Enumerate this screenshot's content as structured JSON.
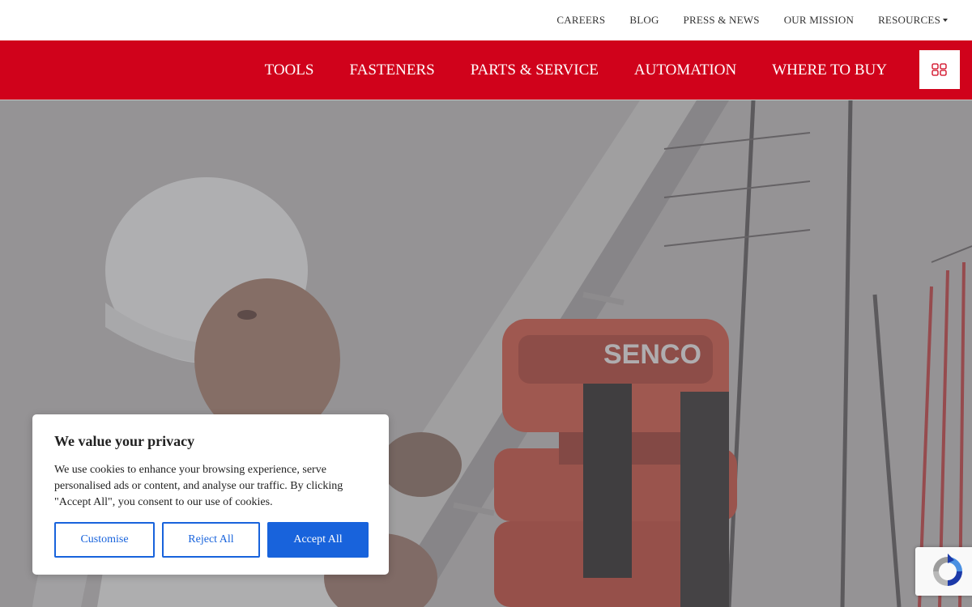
{
  "top_bar": {
    "links": [
      {
        "label": "CAREERS"
      },
      {
        "label": "BLOG"
      },
      {
        "label": "PRESS & NEWS"
      },
      {
        "label": "OUR MISSION"
      },
      {
        "label": "RESOURCES"
      }
    ]
  },
  "main_nav": {
    "items": [
      {
        "label": "TOOLS"
      },
      {
        "label": "FASTENERS"
      },
      {
        "label": "PARTS & SERVICE"
      },
      {
        "label": "AUTOMATION"
      },
      {
        "label": "WHERE TO BUY"
      }
    ],
    "menu_icon": "grid-icon",
    "brand_color": "#d0021b"
  },
  "hero": {
    "tool_brand": "SENCO"
  },
  "cookie_banner": {
    "title": "We value your privacy",
    "text": "We use cookies to enhance your browsing experience, serve personalised ads or content, and analyse our traffic. By clicking \"Accept All\", you consent to our use of cookies.",
    "customise_label": "Customise",
    "reject_label": "Reject All",
    "accept_label": "Accept All",
    "accent_color": "#1863dc"
  },
  "recaptcha": {
    "icon": "recaptcha-icon"
  }
}
